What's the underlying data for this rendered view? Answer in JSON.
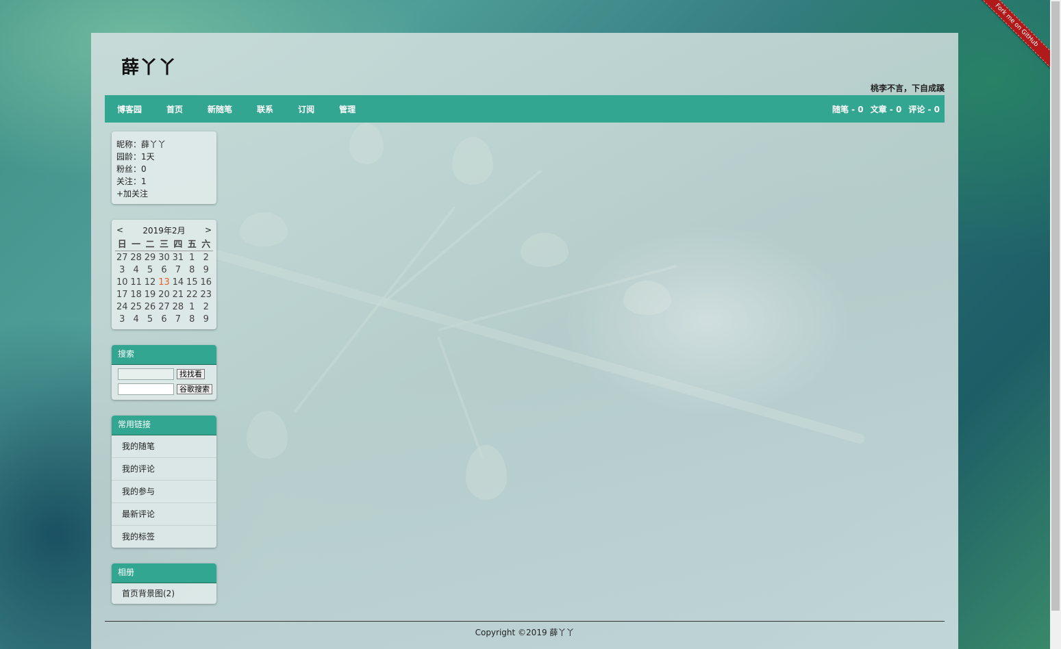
{
  "blog": {
    "title": "薛丫丫",
    "subtitle": "桃李不言，下自成蹊"
  },
  "nav": {
    "items": [
      "博客园",
      "首页",
      "新随笔",
      "联系",
      "订阅",
      "管理"
    ],
    "stats": [
      "随笔 - 0",
      "文章 - 0",
      "评论 - 0"
    ]
  },
  "profile": {
    "nickname": "昵称：薛丫丫",
    "age": "园龄：1天",
    "fans": "粉丝：0",
    "following": "关注：1",
    "follow_label": "+加关注"
  },
  "calendar": {
    "prev": "<",
    "next": ">",
    "month": "2019年2月",
    "weekdays": [
      "日",
      "一",
      "二",
      "三",
      "四",
      "五",
      "六"
    ],
    "weeks": [
      [
        "27",
        "28",
        "29",
        "30",
        "31",
        "1",
        "2"
      ],
      [
        "3",
        "4",
        "5",
        "6",
        "7",
        "8",
        "9"
      ],
      [
        "10",
        "11",
        "12",
        "13",
        "14",
        "15",
        "16"
      ],
      [
        "17",
        "18",
        "19",
        "20",
        "21",
        "22",
        "23"
      ],
      [
        "24",
        "25",
        "26",
        "27",
        "28",
        "1",
        "2"
      ],
      [
        "3",
        "4",
        "5",
        "6",
        "7",
        "8",
        "9"
      ]
    ],
    "today": "13",
    "today_color": "#e4602a"
  },
  "search": {
    "title": "搜索",
    "search_button": "找找看",
    "google_button": "谷歌搜索"
  },
  "links": {
    "title": "常用链接",
    "items": [
      "我的随笔",
      "我的评论",
      "我的参与",
      "最新评论",
      "我的标签"
    ]
  },
  "album": {
    "title": "相册",
    "item": "首页背景图(2)"
  },
  "footer": {
    "copyright": "Copyright ©2019 薛丫丫"
  },
  "ribbon": {
    "label": "Fork me on GitHub",
    "color": "#b11a1a"
  },
  "colors": {
    "accent": "#32a690"
  }
}
